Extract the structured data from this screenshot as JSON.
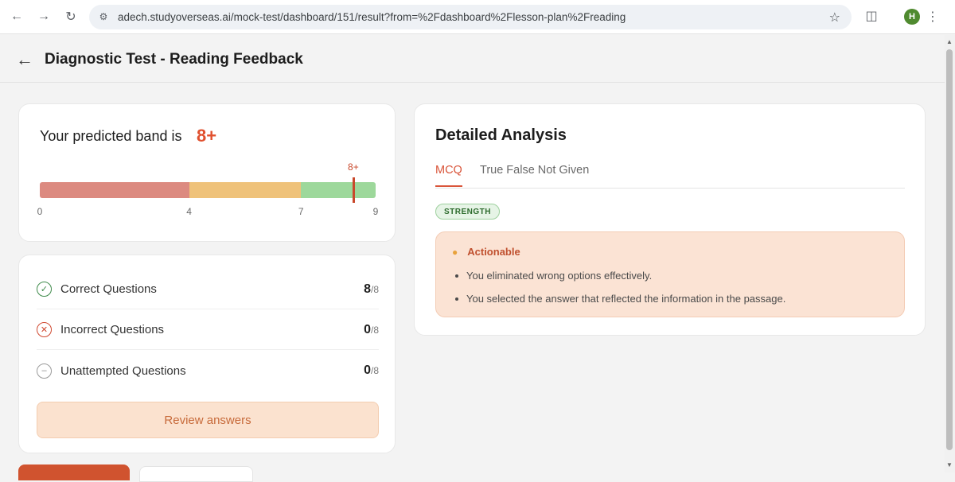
{
  "browser": {
    "url": "adech.studyoverseas.ai/mock-test/dashboard/151/result?from=%2Fdashboard%2Flesson-plan%2Freading",
    "avatar_letter": "H"
  },
  "header": {
    "title": "Diagnostic Test - Reading Feedback"
  },
  "band": {
    "label": "Your predicted band is",
    "value": "8+",
    "marker_label": "8+",
    "marker_position": 8.4,
    "scale_max": 9,
    "segments": [
      {
        "from": 0,
        "to": 4,
        "color": "#dc8a80"
      },
      {
        "from": 4,
        "to": 7,
        "color": "#efc27a"
      },
      {
        "from": 7,
        "to": 9,
        "color": "#9dd89b"
      }
    ],
    "ticks": [
      "0",
      "4",
      "7",
      "9"
    ]
  },
  "stats": {
    "rows": [
      {
        "label": "Correct Questions",
        "value": "8",
        "total": "/8",
        "icon": "check-icon",
        "color": "#3e8a4a"
      },
      {
        "label": "Incorrect Questions",
        "value": "0",
        "total": "/8",
        "icon": "x-icon",
        "color": "#d0482f"
      },
      {
        "label": "Unattempted Questions",
        "value": "0",
        "total": "/8",
        "icon": "dash-icon",
        "color": "#888888"
      }
    ],
    "review_label": "Review answers"
  },
  "analysis": {
    "title": "Detailed Analysis",
    "tabs": [
      "MCQ",
      "True False Not Given"
    ],
    "active_tab": 0,
    "badge": "STRENGTH",
    "actionable_title": "Actionable",
    "items": [
      "You eliminated wrong options effectively.",
      "You selected the answer that reflected the information in the passage."
    ]
  }
}
